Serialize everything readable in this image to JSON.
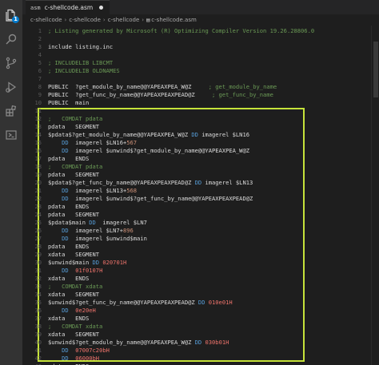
{
  "activity_bar": {
    "items": [
      {
        "name": "explorer-icon",
        "badge": "1"
      },
      {
        "name": "search-icon"
      },
      {
        "name": "source-control-icon"
      },
      {
        "name": "run-debug-icon"
      },
      {
        "name": "extensions-icon"
      },
      {
        "name": "remote-explorer-icon"
      }
    ]
  },
  "tab": {
    "file_icon": "asm",
    "label": "c-shellcode.asm",
    "modified": true
  },
  "breadcrumb": [
    "c-shellcode",
    "c-shellcode",
    "c-shellcode",
    "c-shellcode.asm"
  ],
  "editor": {
    "lines": [
      [
        {
          "c": "cmt",
          "t": "; Listing generated by Microsoft (R) Optimizing Compiler Version 19.26.28806.0"
        }
      ],
      [],
      [
        {
          "c": "txt",
          "t": "include listing.inc"
        }
      ],
      [],
      [
        {
          "c": "cmt",
          "t": "; INCLUDELIB LIBCMT"
        }
      ],
      [
        {
          "c": "cmt",
          "t": "; INCLUDELIB OLDNAMES"
        }
      ],
      [],
      [
        {
          "c": "txt",
          "t": "PUBLIC  ?get_module_by_name@@YAPEAXPEA_W@Z     "
        },
        {
          "c": "cmt",
          "t": "; get_module_by_name"
        }
      ],
      [
        {
          "c": "txt",
          "t": "PUBLIC  ?get_func_by_name@@YAPEAXPEAXPEAD@Z     "
        },
        {
          "c": "cmt",
          "t": "; get_func_by_name"
        }
      ],
      [
        {
          "c": "txt",
          "t": "PUBLIC  main"
        }
      ],
      [],
      [
        {
          "c": "cmt",
          "t": ";   COMDAT pdata"
        }
      ],
      [
        {
          "c": "txt",
          "t": "pdata   SEGMENT"
        }
      ],
      [
        {
          "c": "txt",
          "t": "$pdata$?get_module_by_name@@YAPEAXPEA_W@Z "
        },
        {
          "c": "kw",
          "t": "DD"
        },
        {
          "c": "txt",
          "t": " imagerel $LN16"
        }
      ],
      [
        {
          "c": "txt",
          "t": "    "
        },
        {
          "c": "kw",
          "t": "DD"
        },
        {
          "c": "txt",
          "t": "  imagerel $LN16+"
        },
        {
          "c": "num",
          "t": "567"
        }
      ],
      [
        {
          "c": "txt",
          "t": "    "
        },
        {
          "c": "kw",
          "t": "DD"
        },
        {
          "c": "txt",
          "t": "  imagerel $unwind$?get_module_by_name@@YAPEAXPEA_W@Z"
        }
      ],
      [
        {
          "c": "txt",
          "t": "pdata   ENDS"
        }
      ],
      [
        {
          "c": "cmt",
          "t": ";   COMDAT pdata"
        }
      ],
      [
        {
          "c": "txt",
          "t": "pdata   SEGMENT"
        }
      ],
      [
        {
          "c": "txt",
          "t": "$pdata$?get_func_by_name@@YAPEAXPEAXPEAD@Z "
        },
        {
          "c": "kw",
          "t": "DD"
        },
        {
          "c": "txt",
          "t": " imagerel $LN13"
        }
      ],
      [
        {
          "c": "txt",
          "t": "    "
        },
        {
          "c": "kw",
          "t": "DD"
        },
        {
          "c": "txt",
          "t": "  imagerel $LN13+"
        },
        {
          "c": "num",
          "t": "568"
        }
      ],
      [
        {
          "c": "txt",
          "t": "    "
        },
        {
          "c": "kw",
          "t": "DD"
        },
        {
          "c": "txt",
          "t": "  imagerel $unwind$?get_func_by_name@@YAPEAXPEAXPEAD@Z"
        }
      ],
      [
        {
          "c": "txt",
          "t": "pdata   ENDS"
        }
      ],
      [
        {
          "c": "txt",
          "t": "pdata   SEGMENT"
        }
      ],
      [
        {
          "c": "txt",
          "t": "$pdata$main "
        },
        {
          "c": "kw",
          "t": "DD"
        },
        {
          "c": "txt",
          "t": "  imagerel $LN7"
        }
      ],
      [
        {
          "c": "txt",
          "t": "    "
        },
        {
          "c": "kw",
          "t": "DD"
        },
        {
          "c": "txt",
          "t": "  imagerel $LN7+"
        },
        {
          "c": "num",
          "t": "896"
        }
      ],
      [
        {
          "c": "txt",
          "t": "    "
        },
        {
          "c": "kw",
          "t": "DD"
        },
        {
          "c": "txt",
          "t": "  imagerel $unwind$main"
        }
      ],
      [
        {
          "c": "txt",
          "t": "pdata   ENDS"
        }
      ],
      [
        {
          "c": "txt",
          "t": "xdata   SEGMENT"
        }
      ],
      [
        {
          "c": "txt",
          "t": "$unwind$main "
        },
        {
          "c": "kw",
          "t": "DD"
        },
        {
          "c": "txt",
          "t": " "
        },
        {
          "c": "hex",
          "t": "020701H"
        }
      ],
      [
        {
          "c": "txt",
          "t": "    "
        },
        {
          "c": "kw",
          "t": "DD"
        },
        {
          "c": "txt",
          "t": "  "
        },
        {
          "c": "hex",
          "t": "01f0107H"
        }
      ],
      [
        {
          "c": "txt",
          "t": "xdata   ENDS"
        }
      ],
      [
        {
          "c": "cmt",
          "t": ";   COMDAT xdata"
        }
      ],
      [
        {
          "c": "txt",
          "t": "xdata   SEGMENT"
        }
      ],
      [
        {
          "c": "txt",
          "t": "$unwind$?get_func_by_name@@YAPEAXPEAXPEAD@Z "
        },
        {
          "c": "kw",
          "t": "DD"
        },
        {
          "c": "txt",
          "t": " "
        },
        {
          "c": "hex",
          "t": "010e01H"
        }
      ],
      [
        {
          "c": "txt",
          "t": "    "
        },
        {
          "c": "kw",
          "t": "DD"
        },
        {
          "c": "txt",
          "t": "  "
        },
        {
          "c": "hex",
          "t": "0e20eH"
        }
      ],
      [
        {
          "c": "txt",
          "t": "xdata   ENDS"
        }
      ],
      [
        {
          "c": "cmt",
          "t": ";   COMDAT xdata"
        }
      ],
      [
        {
          "c": "txt",
          "t": "xdata   SEGMENT"
        }
      ],
      [
        {
          "c": "txt",
          "t": "$unwind$?get_module_by_name@@YAPEAXPEA_W@Z "
        },
        {
          "c": "kw",
          "t": "DD"
        },
        {
          "c": "txt",
          "t": " "
        },
        {
          "c": "hex",
          "t": "030b01H"
        }
      ],
      [
        {
          "c": "txt",
          "t": "    "
        },
        {
          "c": "kw",
          "t": "DD"
        },
        {
          "c": "txt",
          "t": "  "
        },
        {
          "c": "hex",
          "t": "07007c20bH"
        }
      ],
      [
        {
          "c": "txt",
          "t": "    "
        },
        {
          "c": "kw",
          "t": "DD"
        },
        {
          "c": "txt",
          "t": "  "
        },
        {
          "c": "hex",
          "t": "06000bH"
        }
      ],
      [
        {
          "c": "txt",
          "t": "xdata   ENDS"
        }
      ]
    ]
  },
  "colors": {
    "highlight_border": "#c6e33a",
    "comment": "#6a9955",
    "keyword": "#569cd6",
    "number": "#ce9178",
    "hex": "#f0746c"
  }
}
